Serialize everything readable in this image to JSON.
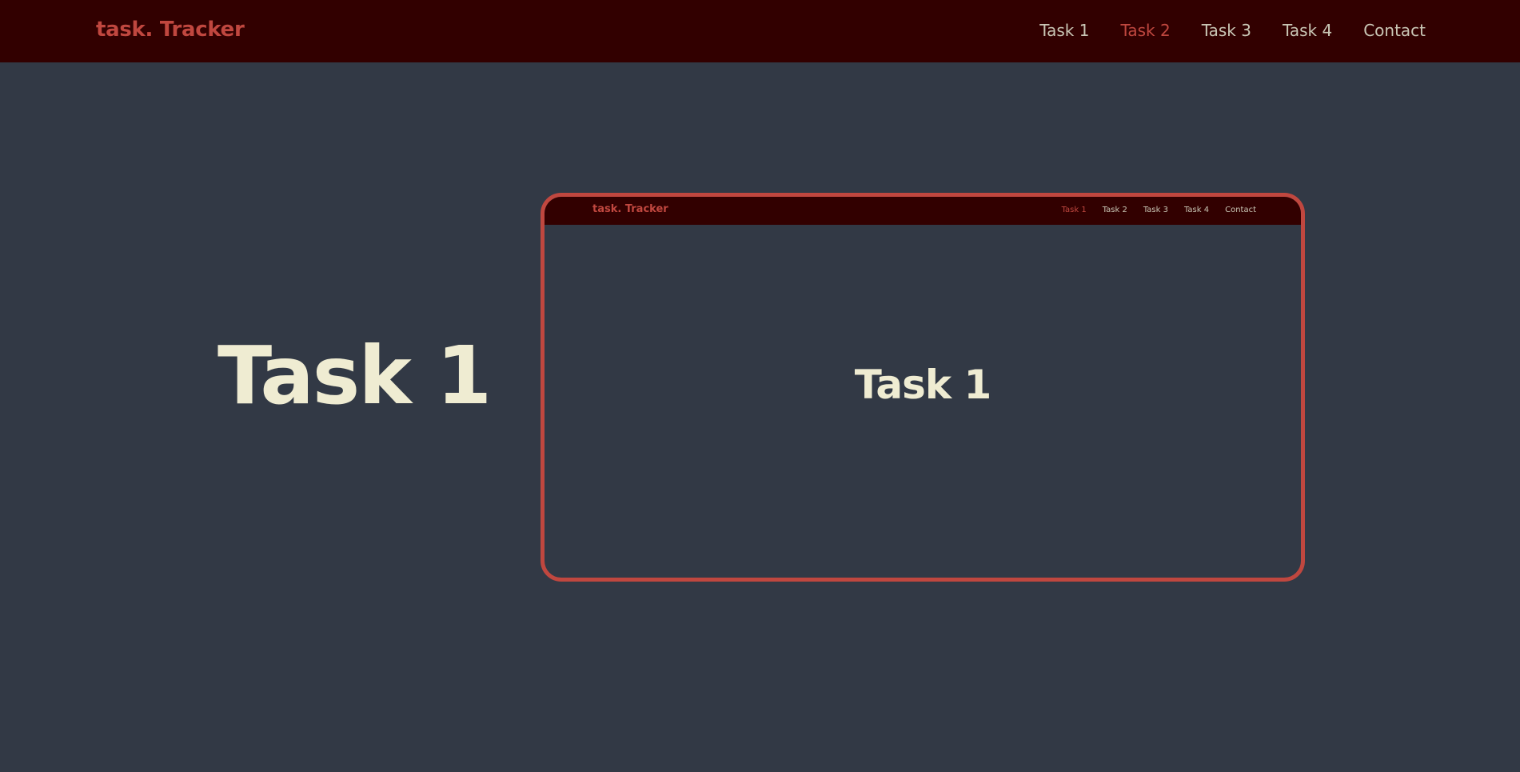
{
  "header": {
    "brand": "task. Tracker",
    "nav": [
      {
        "label": "Task 1",
        "active": false
      },
      {
        "label": "Task 2",
        "active": true
      },
      {
        "label": "Task 3",
        "active": false
      },
      {
        "label": "Task 4",
        "active": false
      },
      {
        "label": "Contact",
        "active": false
      }
    ]
  },
  "hero": {
    "title": "Task 1"
  },
  "preview": {
    "brand": "task. Tracker",
    "nav": [
      {
        "label": "Task 1",
        "active": true
      },
      {
        "label": "Task 2",
        "active": false
      },
      {
        "label": "Task 3",
        "active": false
      },
      {
        "label": "Task 4",
        "active": false
      },
      {
        "label": "Contact",
        "active": false
      }
    ],
    "title": "Task 1"
  },
  "colors": {
    "page_background": "#323945",
    "header_background": "#320000",
    "accent": "#c0473f",
    "nav_text": "#c9c6b5",
    "title_text": "#efecd2"
  }
}
